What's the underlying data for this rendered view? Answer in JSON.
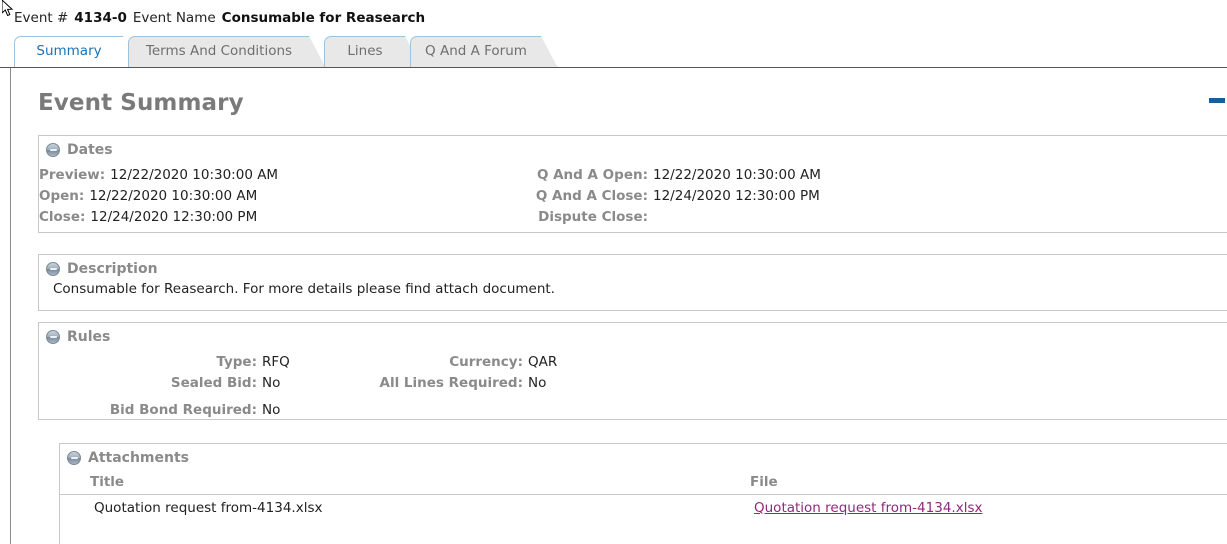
{
  "header": {
    "event_number_label": "Event #",
    "event_number_value": "4134-0",
    "event_name_label": "Event Name",
    "event_name_value": "Consumable for Reasearch"
  },
  "tabs": [
    {
      "label": "Summary",
      "active": true
    },
    {
      "label": "Terms And Conditions",
      "active": false
    },
    {
      "label": "Lines",
      "active": false
    },
    {
      "label": "Q And A Forum",
      "active": false
    }
  ],
  "page": {
    "title": "Event Summary"
  },
  "sections": {
    "dates": {
      "title": "Dates",
      "left_fields": [
        {
          "label": "Preview:",
          "value": "12/22/2020 10:30:00 AM"
        },
        {
          "label": "Open:",
          "value": "12/22/2020 10:30:00 AM"
        },
        {
          "label": "Close:",
          "value": "12/24/2020 12:30:00 PM"
        }
      ],
      "right_fields": [
        {
          "label": "Q And A Open:",
          "value": "12/22/2020 10:30:00 AM"
        },
        {
          "label": "Q And A Close:",
          "value": "12/24/2020 12:30:00 PM"
        },
        {
          "label": "Dispute Close:",
          "value": ""
        }
      ]
    },
    "description": {
      "title": "Description",
      "text": "Consumable for Reasearch. For more details please find attach document."
    },
    "rules": {
      "title": "Rules",
      "left_fields": [
        {
          "label": "Type:",
          "value": "RFQ"
        },
        {
          "label": "Sealed Bid:",
          "value": "No"
        },
        {
          "label": "Bid Bond Required:",
          "value": "No"
        }
      ],
      "right_fields": [
        {
          "label": "Currency:",
          "value": "QAR"
        },
        {
          "label": "All Lines Required:",
          "value": "No"
        }
      ]
    },
    "attachments": {
      "title": "Attachments",
      "columns": [
        "Title",
        "File"
      ],
      "rows": [
        {
          "title": "Quotation request from-4134.xlsx",
          "file": "Quotation request from-4134.xlsx"
        }
      ]
    }
  },
  "controls": {
    "minimize_label": ""
  },
  "colors": {
    "active_tab_text": "#1a73b8",
    "label_grey": "#8a8a8a",
    "link_purple": "#8e2a7a",
    "minimize_blue": "#1b5e9c"
  }
}
